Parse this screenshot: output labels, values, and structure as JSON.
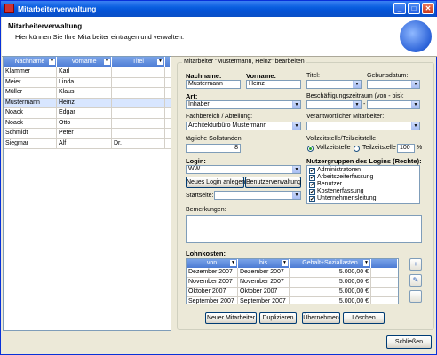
{
  "window": {
    "title": "Mitarbeiterverwaltung"
  },
  "header": {
    "title": "Mitarbeiterverwaltung",
    "subtitle": "Hier können Sie Ihre Mitarbeiter eintragen und verwalten."
  },
  "grid": {
    "columns": [
      "Nachname",
      "Vorname",
      "Titel"
    ],
    "rows": [
      {
        "nachname": "Klammer",
        "vorname": "Karl",
        "titel": ""
      },
      {
        "nachname": "Meier",
        "vorname": "Linda",
        "titel": ""
      },
      {
        "nachname": "Müller",
        "vorname": "Klaus",
        "titel": ""
      },
      {
        "nachname": "Mustermann",
        "vorname": "Heinz",
        "titel": ""
      },
      {
        "nachname": "Noack",
        "vorname": "Edgar",
        "titel": ""
      },
      {
        "nachname": "Noack",
        "vorname": "Otto",
        "titel": ""
      },
      {
        "nachname": "Schmidt",
        "vorname": "Peter",
        "titel": ""
      },
      {
        "nachname": "Siegmar",
        "vorname": "Alf",
        "titel": "Dr."
      }
    ]
  },
  "form": {
    "legend": "Mitarbeiter \"Mustermann, Heinz\" bearbeiten",
    "nachname_label": "Nachname:",
    "nachname_value": "Mustermann",
    "vorname_label": "Vorname:",
    "vorname_value": "Heinz",
    "titel_label": "Titel:",
    "geburtsdatum_label": "Geburtsdatum:",
    "art_label": "Art:",
    "art_value": "Inhaber",
    "zeitraum_label": "Beschäftigungszeitraum (von - bis):",
    "zeitraum_sep": "-",
    "fachbereich_label": "Fachbereich / Abteilung:",
    "fachbereich_value": "Architekturbüro Mustermann",
    "verantwortlich_label": "Verantwortlicher Mitarbeiter:",
    "sollstunden_label": "tägliche Sollstunden:",
    "sollstunden_value": "8",
    "vollzeit_label": "Vollzeitstelle/Teilzeitstelle",
    "vollzeit_option": "Vollzeitstelle",
    "teilzeit_option": "Teilzeitstelle",
    "teilzeit_value": "100",
    "percent": "%",
    "login_label": "Login:",
    "login_value": "WW",
    "neues_login_button": "Neues Login anlegen",
    "benutzerverwaltung_button": "Benutzerverwaltung",
    "startseite_label": "Startseite:",
    "nutzergruppen_label": "Nutzergruppen des Logins (Rechte):",
    "nutzergruppen": [
      "Administratoren",
      "Arbeitszeiterfassung",
      "Benutzer",
      "Kostenerfassung",
      "Unternehmensleitung"
    ],
    "bemerkungen_label": "Bemerkungen:",
    "lohnkosten_label": "Lohnkosten:",
    "lohn_columns": [
      "von",
      "bis",
      "Gehalt+Soziallasten"
    ],
    "lohn_rows": [
      {
        "von": "Dezember 2007",
        "bis": "Dezember 2007",
        "betrag": "5.000,00 €"
      },
      {
        "von": "November 2007",
        "bis": "November 2007",
        "betrag": "5.000,00 €"
      },
      {
        "von": "Oktober 2007",
        "bis": "Oktober 2007",
        "betrag": "5.000,00 €"
      },
      {
        "von": "September 2007",
        "bis": "September 2007",
        "betrag": "5.000,00 €"
      }
    ]
  },
  "actions": {
    "neuer": "Neuer Mitarbeiter",
    "duplizieren": "Duplizieren",
    "uebernehmen": "Übernehmen",
    "loeschen": "Löschen",
    "schliessen": "Schließen"
  },
  "icons": {
    "add": "add-row-icon",
    "edit": "edit-row-icon",
    "delete": "delete-row-icon"
  }
}
